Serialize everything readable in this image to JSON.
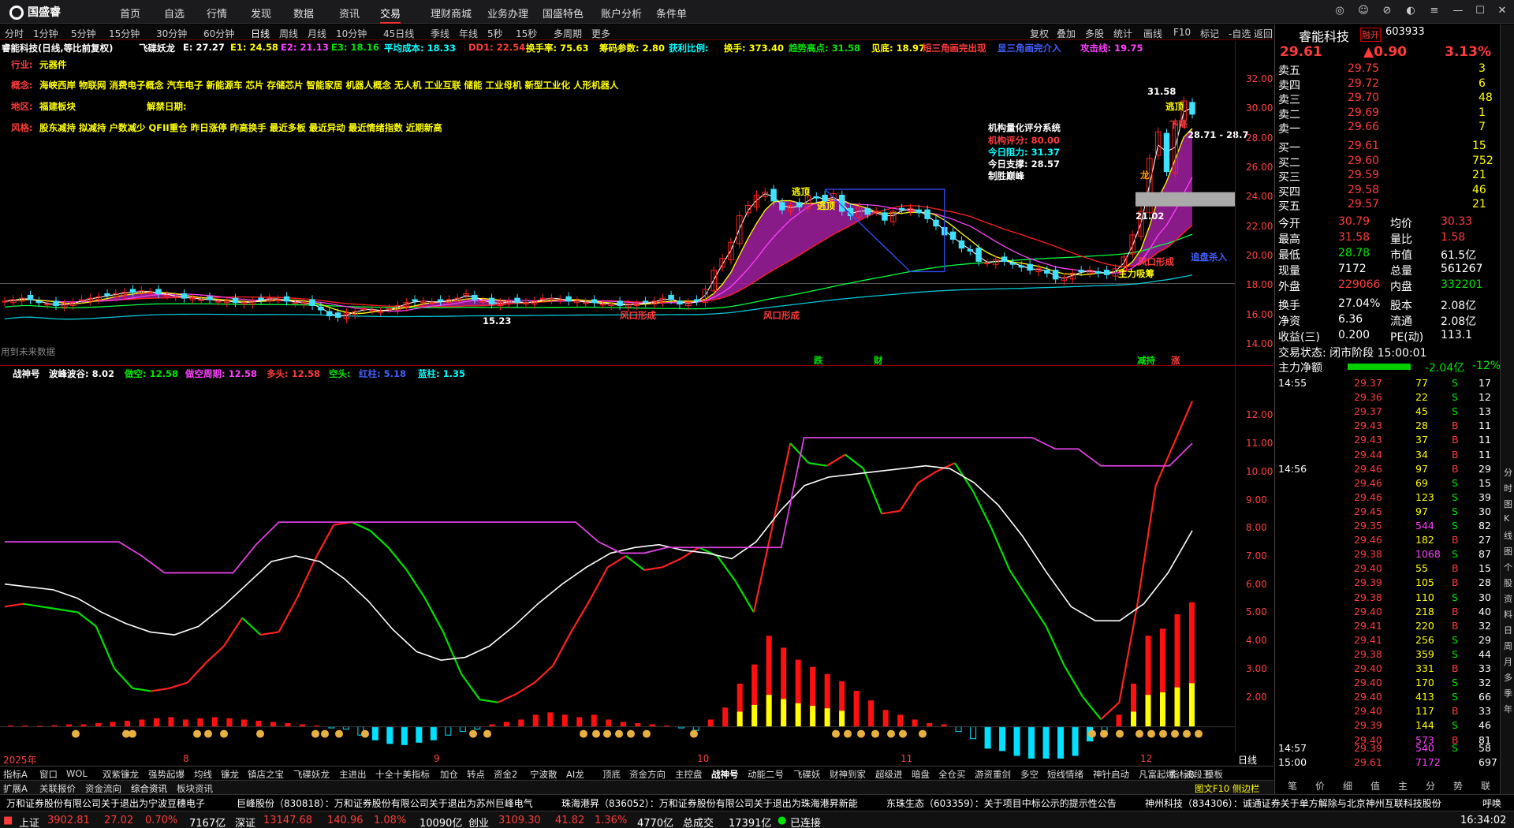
{
  "app": {
    "brand": "国盛睿",
    "nav": [
      "首页",
      "自选",
      "行情",
      "发现",
      "数据",
      "资讯",
      "交易",
      "理财商城",
      "业务办理",
      "国盛特色",
      "账户分析",
      "条件单"
    ],
    "active_nav": "交易"
  },
  "periods": [
    "分时",
    "1分钟",
    "5分钟",
    "15分钟",
    "30分钟",
    "60分钟",
    "日线",
    "周线",
    "月线",
    "10分钟",
    "45日线",
    "季线",
    "年线",
    "5秒",
    "15秒",
    "多周期",
    "更多"
  ],
  "active_period": "日线",
  "toolbar": [
    "复权",
    "叠加",
    "多股",
    "统计",
    "画线",
    "F10",
    "标记",
    "-自选",
    "返回"
  ],
  "stock": {
    "name": "睿能科技",
    "suffix": "(日线,等比前复权)",
    "code": "603933",
    "price": "29.61",
    "change": "▲0.90",
    "pct": "3.13%",
    "badge": "融开"
  },
  "info_line": {
    "indicator": "飞碟妖龙",
    "e": "E: 27.27",
    "e1": "E1: 24.58",
    "e2": "E2: 21.13",
    "e3": "E3: 18.16",
    "avg_cost": "平均成本: 18.33",
    "dd1": "DD1: 22.54",
    "turn_rate": "换手率: 75.63",
    "chip": "筹码参数: 2.80",
    "profit": "获利比例:",
    "hands": "换手: 373.40",
    "trend": "趋势高点: 31.58",
    "top": "见底: 18.97",
    "tri_done": "短三角画完出现",
    "tri_pre": "显三角画完介入",
    "attack": "攻击线: 19.75"
  },
  "tags": {
    "industry_label": "行业:",
    "industry": "元器件",
    "concept_label": "概念:",
    "concept": "海峡西岸 物联网 消费电子概念 汽车电子 新能源车 芯片 存储芯片 智能家居 机器人概念 无人机 工业互联 储能 工业母机 新型工业化 人形机器人",
    "region_label": "地区:",
    "region": "福建板块",
    "unlock_label": "解禁日期:",
    "style_label": "风格:",
    "style": "股东减持 拟减持 户数减少 QFII重仓 昨日涨停 昨高换手 最近多板 最近异动 最近情绪指数 近期新高"
  },
  "quant": {
    "title": "机构量化评分系统",
    "score": "机构评分:  80.00",
    "res": "今日阻力:  31.37",
    "sup": "今日支撑:  28.57",
    "win": "制胜巅峰"
  },
  "annotations": {
    "a1": "逃顶",
    "a2": "逃顶",
    "a3": "逃顶",
    "a4": "下降",
    "a5": "龙",
    "mouth1": "风口形成",
    "mouth2": "风口形成",
    "mouth3": "风口形成",
    "absorb": "主力吸筹",
    "chase": "追盘杀入",
    "hi": "31.58",
    "hi2": "28.71 - 28.7",
    "lo": "15.23",
    "last": "21.02",
    "noentry": "用到未来数据",
    "fall": "跌",
    "cai": "财",
    "jian": "减持",
    "zhang": "涨",
    "s": "S",
    "b": "B"
  },
  "lower": {
    "name": "战神号",
    "wave": "波峰波谷: 8.02",
    "v1": "做空: 12.58",
    "v2": "做空周期: 12.58",
    "v3": "多头: 12.58",
    "v4": "空头:",
    "v5": "红柱: 5.18",
    "v6": "蓝柱: 1.35"
  },
  "y_upper": [
    "32.00",
    "30.00",
    "28.00",
    "26.00",
    "24.00",
    "22.00",
    "20.00",
    "18.00",
    "16.00",
    "14.00"
  ],
  "y_lower": [
    "12.00",
    "11.00",
    "10.00",
    "9.00",
    "8.00",
    "7.00",
    "6.00",
    "5.00",
    "4.00",
    "3.00",
    "2.00"
  ],
  "x_ticks": [
    "2025年",
    "8",
    "9",
    "10",
    "11",
    "12"
  ],
  "x_right": "日线",
  "bottom_tabs": [
    "指标A",
    "窗口",
    "WOL",
    "双紫镰龙",
    "强势起爆",
    "均线",
    "镰龙",
    "镇店之宝",
    "飞碟妖龙",
    "主进出",
    "十全十美指标",
    "加仓",
    "转点",
    "资金2",
    "宁波散",
    "AI龙",
    "顶底",
    "资金方向",
    "主控盘",
    "战神号",
    "动能二号",
    "飞碟妖",
    "财神到家",
    "超级进",
    "暗盘",
    "全仓买",
    "游资重剑",
    "多空",
    "短线情绪",
    "神针启动",
    "凡富起爆",
    "波段王"
  ],
  "bottom_tabs_right": [
    "指标B",
    "模板"
  ],
  "bottom_tabs2": [
    "扩展A",
    "关联报价",
    "资金流向",
    "综合资讯",
    "板块资讯"
  ],
  "bottom_tabs2_right": "图文F10 侧边栏",
  "ticker": [
    "万和证券股份有限公司关于退出为宁波豆穗电子",
    "巨峰股份（830818）：万和证券股份有限公司关于退出为苏州巨峰电气",
    "珠海港昇（836052）：万和证券股份有限公司关于退出为珠海港昇新能",
    "东珠生态（603359）：关于项目中标公示的提示性公告",
    "神州科技（834306）：诚通证券关于单方解除与北京神州互联科技股份"
  ],
  "ticker_right": "呼唤",
  "status": {
    "sh": "上证",
    "sh_v": "3902.81",
    "sh_c": "27.02",
    "sh_p": "0.70%",
    "sh_a": "7167亿",
    "sz": "深证",
    "sz_v": "13147.68",
    "sz_c": "140.96",
    "sz_p": "1.08%",
    "sz_a": "10090亿",
    "cy": "创业",
    "cy_v": "3109.30",
    "cy_c": "41.82",
    "cy_p": "1.36%",
    "cy_a": "4770亿",
    "total": "总成交",
    "total_v": "17391亿",
    "conn": "已连接",
    "time": "16:34:02"
  },
  "orderbook": {
    "asks": [
      [
        "卖五",
        "29.75",
        "3"
      ],
      [
        "卖四",
        "29.72",
        "6"
      ],
      [
        "卖三",
        "29.70",
        "48"
      ],
      [
        "卖二",
        "29.69",
        "1"
      ],
      [
        "卖一",
        "29.66",
        "7"
      ]
    ],
    "bids": [
      [
        "买一",
        "29.61",
        "15"
      ],
      [
        "买二",
        "29.60",
        "752"
      ],
      [
        "买三",
        "29.59",
        "21"
      ],
      [
        "买四",
        "29.58",
        "46"
      ],
      [
        "买五",
        "29.57",
        "21"
      ]
    ]
  },
  "stats": [
    [
      "今开",
      "30.79",
      "均价",
      "30.33"
    ],
    [
      "最高",
      "31.58",
      "量比",
      "1.58"
    ],
    [
      "最低",
      "28.78",
      "市值",
      "61.5亿"
    ],
    [
      "现量",
      "7172",
      "总量",
      "561267"
    ],
    [
      "外盘",
      "229066",
      "内盘",
      "332201"
    ],
    [
      "换手",
      "27.04%",
      "股本",
      "2.08亿"
    ],
    [
      "净资",
      "6.36",
      "流通",
      "2.08亿"
    ],
    [
      "收益(三)",
      "0.200",
      "PE(动)",
      "113.1"
    ]
  ],
  "trade_state": "交易状态: 闭市阶段 15:00:01",
  "main_flow": {
    "label": "主力净额",
    "value": "-2.04亿",
    "pct": "-12%"
  },
  "trades": [
    [
      "14:55",
      "29.37",
      "77",
      "S",
      "17"
    ],
    [
      "",
      "29.36",
      "22",
      "S",
      "12"
    ],
    [
      "",
      "29.37",
      "45",
      "S",
      "13"
    ],
    [
      "",
      "29.43",
      "28",
      "B",
      "11"
    ],
    [
      "",
      "29.43",
      "37",
      "B",
      "11"
    ],
    [
      "",
      "29.44",
      "34",
      "B",
      "11"
    ],
    [
      "14:56",
      "29.46",
      "97",
      "B",
      "29"
    ],
    [
      "",
      "29.46",
      "69",
      "S",
      "15"
    ],
    [
      "",
      "29.46",
      "123",
      "S",
      "39"
    ],
    [
      "",
      "29.45",
      "97",
      "S",
      "30"
    ],
    [
      "",
      "29.35",
      "544",
      "S",
      "82"
    ],
    [
      "",
      "29.46",
      "182",
      "B",
      "27"
    ],
    [
      "",
      "29.38",
      "1068",
      "S",
      "87"
    ],
    [
      "",
      "29.40",
      "55",
      "B",
      "15"
    ],
    [
      "",
      "29.39",
      "105",
      "B",
      "28"
    ],
    [
      "",
      "29.38",
      "110",
      "S",
      "30"
    ],
    [
      "",
      "29.40",
      "218",
      "B",
      "40"
    ],
    [
      "",
      "29.41",
      "220",
      "B",
      "32"
    ],
    [
      "",
      "29.41",
      "256",
      "S",
      "29"
    ],
    [
      "",
      "29.38",
      "359",
      "S",
      "44"
    ],
    [
      "",
      "29.40",
      "331",
      "B",
      "33"
    ],
    [
      "",
      "29.40",
      "170",
      "S",
      "32"
    ],
    [
      "",
      "29.40",
      "413",
      "S",
      "66"
    ],
    [
      "",
      "29.40",
      "117",
      "B",
      "33"
    ],
    [
      "",
      "29.39",
      "144",
      "S",
      "46"
    ],
    [
      "",
      "29.40",
      "573",
      "B",
      "81"
    ],
    [
      "14:57",
      "29.39",
      "540",
      "S",
      "58"
    ],
    [
      "15:00",
      "29.61",
      "7172",
      "",
      "697"
    ]
  ],
  "rp_tabs": [
    "笔",
    "价",
    "细",
    "值",
    "主",
    "分",
    "势",
    "联"
  ],
  "vtabs": [
    "分",
    "时",
    "图",
    "K",
    "线",
    "图",
    "个",
    "股",
    "资",
    "料",
    "日",
    "周",
    "月",
    "多",
    "季",
    "年"
  ],
  "chart_data": {
    "type": "candlestick",
    "series": [
      "K线",
      "均线",
      "战神号"
    ],
    "ylim_upper": [
      14,
      32
    ],
    "ylim_lower": [
      1,
      12.6
    ],
    "closes": [
      16.9,
      17.0,
      17.1,
      17.0,
      16.8,
      16.7,
      16.6,
      16.7,
      16.8,
      17.0,
      17.1,
      17.2,
      17.3,
      17.4,
      17.5,
      17.5,
      17.6,
      17.5,
      17.4,
      17.3,
      17.2,
      17.1,
      17.1,
      17.0,
      17.0,
      16.9,
      16.9,
      16.8,
      16.8,
      16.9,
      17.0,
      17.1,
      17.0,
      16.9,
      16.8,
      16.8,
      16.6,
      16.3,
      15.9,
      15.8,
      16.1,
      16.2,
      16.4,
      16.3,
      16.2,
      16.4,
      16.6,
      16.8,
      16.9,
      16.9,
      16.8,
      16.9,
      17.0,
      17.1,
      17.4,
      17.0,
      16.9,
      16.7,
      16.8,
      16.9,
      16.8,
      16.8,
      16.9,
      17.1,
      17.1,
      17.0,
      16.9,
      16.9,
      16.8,
      16.8,
      16.7,
      16.7,
      16.6,
      16.7,
      16.7,
      16.8,
      16.9,
      17.1,
      17.0,
      16.7,
      16.8,
      16.9,
      17.7,
      19.0,
      19.8,
      20.9,
      22.7,
      23.4,
      24.1,
      24.3,
      23.7,
      23.1,
      23.4,
      23.3,
      24.1,
      23.9,
      23.7,
      24.2,
      23.0,
      22.7,
      23.3,
      22.8,
      23.0,
      22.4,
      23.0,
      23.1,
      23.2,
      22.9,
      22.5,
      22.0,
      21.4,
      21.1,
      20.5,
      20.3,
      19.6,
      19.5,
      19.7,
      19.6,
      19.4,
      19.2,
      19.0,
      19.1,
      18.8,
      18.4,
      18.5,
      18.8,
      18.9,
      19.0,
      18.8,
      18.7,
      19.1,
      19.9,
      21.4,
      23.0,
      26.6,
      28.4,
      25.7,
      29.0,
      30.5,
      29.6
    ]
  }
}
